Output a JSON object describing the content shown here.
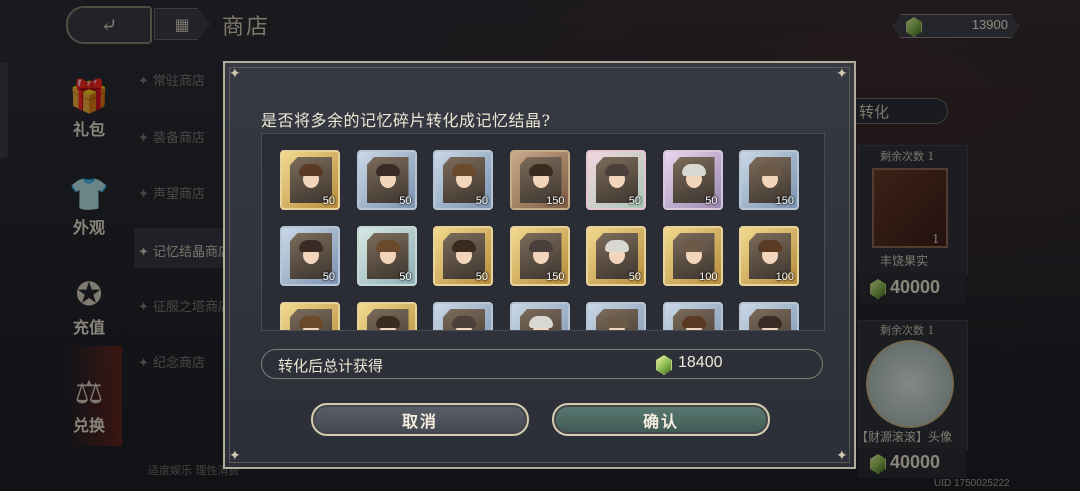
{
  "header": {
    "title": "商店",
    "currency": "13900"
  },
  "sidebar": [
    {
      "label": "礼包",
      "icon": "gift-icon"
    },
    {
      "label": "外观",
      "icon": "outfit-icon"
    },
    {
      "label": "充值",
      "icon": "star-icon"
    },
    {
      "label": "兑换",
      "icon": "exchange-icon"
    }
  ],
  "shop_list": [
    "常驻商店",
    "装备商店",
    "声望商店",
    "记忆结晶商店",
    "征服之塔商店",
    "纪念商店"
  ],
  "disclaimer": "适度娱乐 理性消费",
  "right_panel": {
    "convert_tag": "转化",
    "remaining_label": "剩余次数 1",
    "item1_name": "丰饶果实",
    "item1_count": "1",
    "item1_price": "40000",
    "item2_name": "【财源滚滚】头像",
    "item2_price": "40000"
  },
  "uid": "UID 1750025222",
  "dialog": {
    "question": "是否将多余的记忆碎片转化成记忆结晶?",
    "cards_row1": [
      {
        "count": "50",
        "style": "gold"
      },
      {
        "count": "50",
        "style": "blue"
      },
      {
        "count": "50",
        "style": "blue"
      },
      {
        "count": "150",
        "style": "bronze"
      },
      {
        "count": "50",
        "style": "pink"
      },
      {
        "count": "50",
        "style": "purple"
      },
      {
        "count": "150",
        "style": "blue"
      }
    ],
    "cards_row2": [
      {
        "count": "50",
        "style": "blue"
      },
      {
        "count": "50",
        "style": "teal"
      },
      {
        "count": "50",
        "style": "gold"
      },
      {
        "count": "150",
        "style": "gold"
      },
      {
        "count": "50",
        "style": "gold"
      },
      {
        "count": "100",
        "style": "gold"
      },
      {
        "count": "100",
        "style": "gold"
      }
    ],
    "cards_row3": [
      {
        "count": "",
        "style": "gold"
      },
      {
        "count": "",
        "style": "gold"
      },
      {
        "count": "",
        "style": "blue"
      },
      {
        "count": "",
        "style": "blue"
      },
      {
        "count": "",
        "style": "blue"
      },
      {
        "count": "",
        "style": "blue"
      },
      {
        "count": "",
        "style": "blue"
      }
    ],
    "total_label": "转化后总计获得",
    "total_value": "18400",
    "cancel_label": "取消",
    "confirm_label": "确认"
  }
}
